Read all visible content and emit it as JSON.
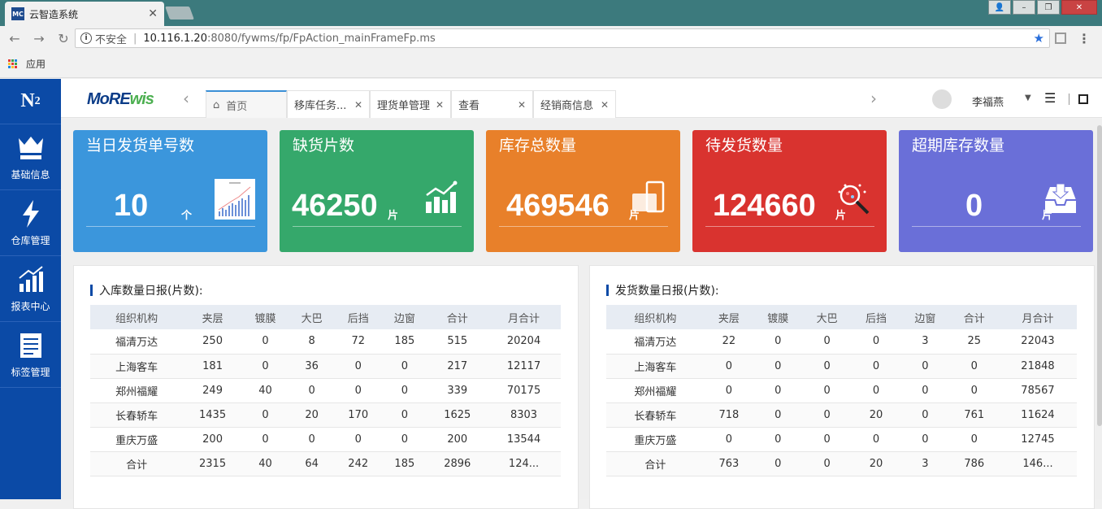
{
  "browser": {
    "tab_title": "云智造系统",
    "tab_favicon": "MC",
    "security_label": "不安全",
    "url_host": "10.116.1.20",
    "url_rest": ":8080/fywms/fp/FpAction_mainFrameFp.ms",
    "bookmark_apps": "应用"
  },
  "sidebar": {
    "logo": "N",
    "logo_sub": "2",
    "items": [
      {
        "label": "基础信息",
        "icon": "crown-icon"
      },
      {
        "label": "仓库管理",
        "icon": "lightning-icon"
      },
      {
        "label": "报表中心",
        "icon": "bar-chart-icon"
      },
      {
        "label": "标签管理",
        "icon": "document-list-icon"
      }
    ]
  },
  "appbar": {
    "brand_main": "MoRE",
    "brand_green": "wis",
    "tabs": [
      {
        "label": "首页",
        "closable": false
      },
      {
        "label": "移库任务...",
        "closable": true
      },
      {
        "label": "理货单管理",
        "closable": true
      },
      {
        "label": "查看",
        "closable": true
      },
      {
        "label": "经销商信息",
        "closable": true
      }
    ],
    "user_name": "李福燕"
  },
  "cards": [
    {
      "title": "当日发货单号数",
      "value": "10",
      "unit": "个",
      "color": "#3b96dc",
      "icon": "chart-thumbnail-icon"
    },
    {
      "title": "缺货片数",
      "value": "46250",
      "unit": "片",
      "color": "#35a86b",
      "icon": "growth-chart-icon"
    },
    {
      "title": "库存总数量",
      "value": "469546",
      "unit": "片",
      "color": "#e8802a",
      "icon": "device-icon"
    },
    {
      "title": "待发货数量",
      "value": "124660",
      "unit": "片",
      "color": "#d9332f",
      "icon": "magnifier-icon"
    },
    {
      "title": "超期库存数量",
      "value": "0",
      "unit": "片",
      "color": "#6a6fd8",
      "icon": "inbox-icon"
    }
  ],
  "inbound": {
    "title": "入库数量日报(片数):",
    "headers": [
      "组织机构",
      "夹层",
      "镀膜",
      "大巴",
      "后挡",
      "边窗",
      "合计",
      "月合计"
    ],
    "rows": [
      [
        "福清万达",
        "250",
        "0",
        "8",
        "72",
        "185",
        "515",
        "20204"
      ],
      [
        "上海客车",
        "181",
        "0",
        "36",
        "0",
        "0",
        "217",
        "12117"
      ],
      [
        "郑州福耀",
        "249",
        "40",
        "0",
        "0",
        "0",
        "339",
        "70175"
      ],
      [
        "长春轿车",
        "1435",
        "0",
        "20",
        "170",
        "0",
        "1625",
        "8303"
      ],
      [
        "重庆万盛",
        "200",
        "0",
        "0",
        "0",
        "0",
        "200",
        "13544"
      ],
      [
        "合计",
        "2315",
        "40",
        "64",
        "242",
        "185",
        "2896",
        "124..."
      ]
    ]
  },
  "outbound": {
    "title": "发货数量日报(片数):",
    "headers": [
      "组织机构",
      "夹层",
      "镀膜",
      "大巴",
      "后挡",
      "边窗",
      "合计",
      "月合计"
    ],
    "rows": [
      [
        "福清万达",
        "22",
        "0",
        "0",
        "0",
        "3",
        "25",
        "22043"
      ],
      [
        "上海客车",
        "0",
        "0",
        "0",
        "0",
        "0",
        "0",
        "21848"
      ],
      [
        "郑州福耀",
        "0",
        "0",
        "0",
        "0",
        "0",
        "0",
        "78567"
      ],
      [
        "长春轿车",
        "718",
        "0",
        "0",
        "20",
        "0",
        "761",
        "11624"
      ],
      [
        "重庆万盛",
        "0",
        "0",
        "0",
        "0",
        "0",
        "0",
        "12745"
      ],
      [
        "合计",
        "763",
        "0",
        "0",
        "20",
        "3",
        "786",
        "146..."
      ]
    ]
  }
}
